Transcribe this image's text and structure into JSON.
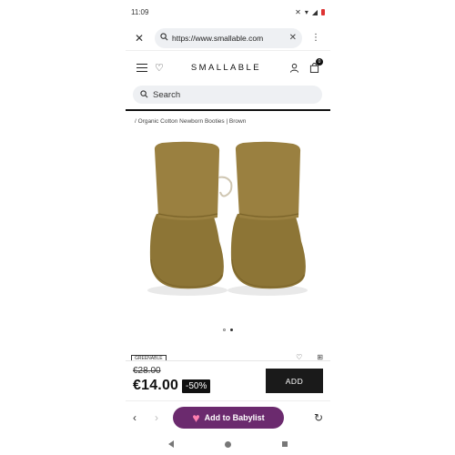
{
  "status": {
    "time": "11:09"
  },
  "browser": {
    "url": "https://www.smallable.com"
  },
  "site": {
    "logo": "SMALLABLE",
    "cart_count": "0",
    "search_placeholder": "Search"
  },
  "product": {
    "breadcrumb": "/ Organic Cotton Newborn Booties | Brown",
    "tag": "GREENABLE",
    "old_price": "€28.00",
    "price": "€14.00",
    "discount": "-50%",
    "add_label": "ADD"
  },
  "carousel": {
    "current": 2,
    "total": 2
  },
  "browser_bottom": {
    "babylist_label": "Add to Babylist"
  },
  "colors": {
    "accent": "#6b2a6e",
    "dark": "#1a1a1a",
    "bootie": "#8b7134"
  },
  "icons": [
    "close-icon",
    "search-icon",
    "clear-icon",
    "menu-icon",
    "hamburger-icon",
    "heart-icon",
    "user-icon",
    "bag-icon",
    "back-icon",
    "forward-icon",
    "refresh-icon"
  ]
}
